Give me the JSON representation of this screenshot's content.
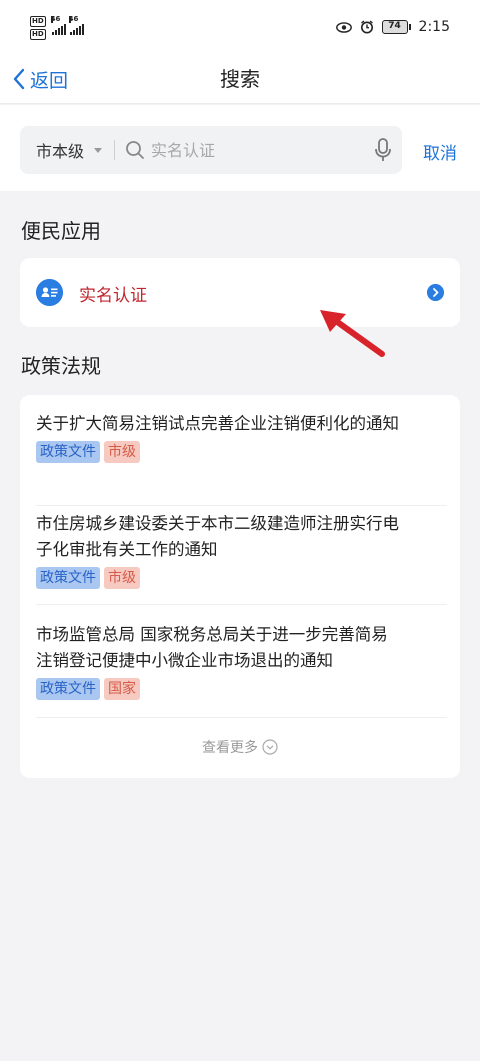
{
  "status_bar": {
    "sim1": "HD",
    "sim2": "HD",
    "network1": "46",
    "network2": "46",
    "battery": "74",
    "time": "2:15"
  },
  "nav": {
    "back_label": "返回",
    "title": "搜索"
  },
  "search": {
    "scope": "市本级",
    "placeholder": "实名认证",
    "cancel_label": "取消"
  },
  "sections": {
    "apps_title": "便民应用",
    "policy_title": "政策法规"
  },
  "apps": [
    {
      "label": "实名认证",
      "icon": "id-card-icon"
    }
  ],
  "policies": [
    {
      "title": "关于扩大简易注销试点完善企业注销便利化的通知",
      "tags": [
        "政策文件",
        "市级"
      ]
    },
    {
      "title_line1": "市住房城乡建设委关于本市二级建造师注册实行电",
      "title_line2": "子化审批有关工作的通知",
      "tags": [
        "政策文件",
        "市级"
      ]
    },
    {
      "title_line1": "市场监管总局 国家税务总局关于进一步完善简易",
      "title_line2": "注销登记便捷中小微企业市场退出的通知",
      "tags": [
        "政策文件",
        "国家"
      ]
    }
  ],
  "more_label": "查看更多",
  "colors": {
    "accent": "#1e73d8",
    "app_label": "#c0262d",
    "tag_blue_bg": "#a9c7f1",
    "tag_red_bg": "#f6c9c1",
    "arrow": "#d8232a"
  }
}
